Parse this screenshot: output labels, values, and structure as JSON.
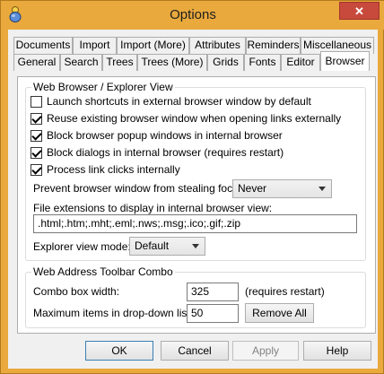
{
  "window": {
    "title": "Options"
  },
  "titlebar": {
    "close_glyph": "✕"
  },
  "tabs_row1": [
    {
      "label": "Documents"
    },
    {
      "label": "Import"
    },
    {
      "label": "Import (More)"
    },
    {
      "label": "Attributes"
    },
    {
      "label": "Reminders"
    },
    {
      "label": "Miscellaneous"
    }
  ],
  "tabs_row2": [
    {
      "label": "General"
    },
    {
      "label": "Search"
    },
    {
      "label": "Trees"
    },
    {
      "label": "Trees (More)"
    },
    {
      "label": "Grids"
    },
    {
      "label": "Fonts"
    },
    {
      "label": "Editor"
    },
    {
      "label": "Browser",
      "active": true
    }
  ],
  "web_browser_group": {
    "title": "Web Browser / Explorer View",
    "options": [
      {
        "label": "Launch shortcuts in external browser window by default",
        "checked": false
      },
      {
        "label": "Reuse existing browser window when opening links externally",
        "checked": true
      },
      {
        "label": "Block browser popup windows in internal browser",
        "checked": true
      },
      {
        "label": "Block dialogs in internal browser (requires restart)",
        "checked": true
      },
      {
        "label": "Process link clicks internally",
        "checked": true
      }
    ],
    "prevent_focus_label": "Prevent browser window from stealing focus:",
    "prevent_focus_value": "Never",
    "extensions_label": "File extensions to display in internal browser view:",
    "extensions_value": ".html;.htm;.mht;.eml;.nws;.msg;.ico;.gif;.zip",
    "explorer_mode_label": "Explorer view mode:",
    "explorer_mode_value": "Default"
  },
  "address_toolbar_group": {
    "title": "Web Address Toolbar Combo",
    "combo_width_label": "Combo box width:",
    "combo_width_value": "325",
    "requires_restart_note": "(requires restart)",
    "max_items_label": "Maximum items in drop-down list:",
    "max_items_value": "50",
    "remove_all_label": "Remove All"
  },
  "footer": {
    "ok_label": "OK",
    "cancel_label": "Cancel",
    "apply_label": "Apply",
    "help_label": "Help"
  }
}
